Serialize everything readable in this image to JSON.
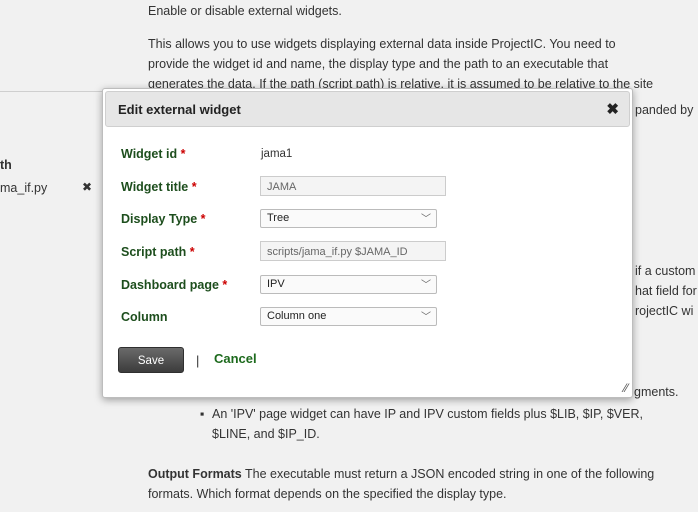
{
  "background": {
    "top_line": "Enable or disable external widgets.",
    "para1": [
      "This allows you to use widgets displaying external data inside ProjectIC. You need to",
      "provide the widget id and name, the display type and the path to an executable that",
      "generates the data. If the path (script path) is relative, it is assumed to be relative to the site"
    ],
    "left_header": "th",
    "left_file": "ma_if.py",
    "right_fragments": [
      "panded by",
      "if a custom",
      "hat field for",
      "rojectIC wi"
    ],
    "partial_bullet": "gments.",
    "bullet": "An 'IPV' page widget can have IP and IPV custom fields plus $LIB, $IP, $VER,",
    "bullet_cont": "$LINE, and $IP_ID.",
    "output_label": "Output Formats",
    "output_text": " The executable must return a JSON encoded string in one of the following",
    "output_text2": "formats. Which format depends on the specified the display type."
  },
  "dialog": {
    "title": "Edit external widget",
    "close": "✖",
    "fields": {
      "widget_id": {
        "label": "Widget id",
        "value": "jama1"
      },
      "widget_title": {
        "label": "Widget title",
        "value": "JAMA"
      },
      "display_type": {
        "label": "Display Type",
        "value": "Tree"
      },
      "script_path": {
        "label": "Script path",
        "value": "scripts/jama_if.py $JAMA_ID"
      },
      "dashboard_page": {
        "label": "Dashboard page",
        "value": "IPV"
      },
      "column": {
        "label": "Column",
        "value": "Column one"
      }
    },
    "required_mark": "*",
    "save_label": "Save",
    "separator": "|",
    "cancel_label": "Cancel"
  }
}
